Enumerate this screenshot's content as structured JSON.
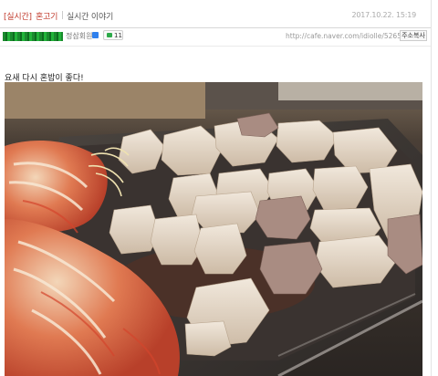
{
  "header": {
    "category": "[실시간]",
    "title": "혼고기",
    "board": "실시간 이야기",
    "date": "2017.10.22. 15:19"
  },
  "author": {
    "grade": "정삼회원",
    "comment_count": "11",
    "url": "http://cafe.naver.com/idiolle/526510",
    "copy_label": "주소복사"
  },
  "post": {
    "body": "요새 다시 혼밥이 좋다!",
    "photo_description": "korean-bbq-grill-pork-belly-kimchi"
  },
  "colors": {
    "title": "#c0392b",
    "author_name": "#1a8a2e",
    "comment_icon": "#2eaa4a"
  }
}
